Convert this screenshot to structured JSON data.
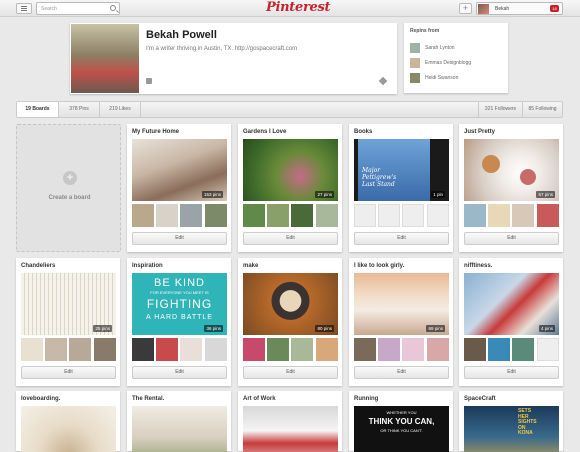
{
  "topbar": {
    "search_placeholder": "Search",
    "logo": "Pinterest",
    "user_name": "Bekah",
    "notif_count": "18"
  },
  "profile": {
    "name": "Bekah Powell",
    "bio": "I'm a writer thriving in Austin, TX. http://gospacecraft.com"
  },
  "repins": {
    "title": "Repins from",
    "items": [
      {
        "label": "Sarah Lynton"
      },
      {
        "label": "Emmas Designblogg"
      },
      {
        "label": "Heidi Swanson"
      }
    ]
  },
  "tabs": {
    "boards": "19 Boards",
    "pins": "378 Pins",
    "likes": "219 Likes",
    "followers": "321 Followers",
    "following": "85 Following"
  },
  "create_board": "Create a board",
  "edit_label": "Edit",
  "boards": [
    {
      "title": "My Future Home",
      "pins": "153 pins"
    },
    {
      "title": "Gardens I Love",
      "pins": "27 pins"
    },
    {
      "title": "Books",
      "pins": "1 pin"
    },
    {
      "title": "Just Pretty",
      "pins": "57 pins"
    },
    {
      "title": "Chandeliers",
      "pins": "25 pins"
    },
    {
      "title": "Inspiration",
      "pins": "36 pins"
    },
    {
      "title": "make",
      "pins": "80 pins"
    },
    {
      "title": "I like to look girly.",
      "pins": "69 pins"
    },
    {
      "title": "nifftiness.",
      "pins": "4 pins"
    },
    {
      "title": "loveboarding."
    },
    {
      "title": "The Rental."
    },
    {
      "title": "Art of Work"
    },
    {
      "title": "Running"
    },
    {
      "title": "SpaceCraft"
    }
  ],
  "cover_text": {
    "book": [
      "Major",
      "Pettigrew's",
      "Last Stand"
    ],
    "inspiration": [
      "BE KIND",
      "FOR EVERYONE YOU MEET IS",
      "FIGHTING",
      "A HARD BATTLE"
    ],
    "running": [
      "WHETHER YOU",
      "THINK YOU CAN,",
      "OR THINK YOU CAN'T."
    ],
    "spacecraft": [
      "SETS",
      "HER",
      "SIGHTS",
      "ON",
      "KONA"
    ]
  }
}
